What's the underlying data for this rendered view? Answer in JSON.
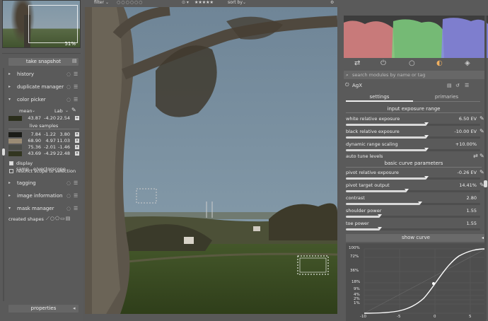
{
  "colors": {
    "accent": "#e8e8e8",
    "picker_primary": "#2b2e1c",
    "live1": "#1b1c18",
    "live2": "#9a8b75",
    "live3": "#4b4d49",
    "live4": "#323520"
  },
  "left": {
    "thumbnail_zoom": "51%",
    "snapshot_label": "take snapshot",
    "modules": [
      {
        "label": "history",
        "arrow": "▸"
      },
      {
        "label": "duplicate manager",
        "arrow": "▸"
      },
      {
        "label": "color picker",
        "arrow": "▾"
      }
    ],
    "picker": {
      "mode": "mean",
      "space": "Lab",
      "primary": [
        "43.87",
        "-4.20",
        "22.54"
      ],
      "live_samples_label": "live samples",
      "samples": [
        [
          "7.84",
          "-1.22",
          "3.80"
        ],
        [
          "68.90",
          "4.97",
          "11.03"
        ],
        [
          "75.36",
          "-2.01",
          "-1.46"
        ],
        [
          "43.69",
          "-4.29",
          "22.48"
        ]
      ],
      "display_label": "display samp...e/vectorscope",
      "restrict_label": "restrict scope to selection"
    },
    "modules2": [
      {
        "label": "tagging",
        "arrow": "▸"
      },
      {
        "label": "image information",
        "arrow": "▸"
      },
      {
        "label": "mask manager",
        "arrow": "▾"
      }
    ],
    "created_shapes": "created shapes",
    "properties_label": "properties"
  },
  "topbar": {
    "filter": "filter",
    "stars": "★★★★★",
    "sort": "sort by"
  },
  "right": {
    "search_placeholder": "search modules by name or tag",
    "module_name": "AgX",
    "tabs": [
      "settings",
      "primaries"
    ],
    "section1": "input exposure range",
    "params1": [
      {
        "label": "white relative exposure",
        "value": "6.50 EV",
        "fraction": 0.6
      },
      {
        "label": "black relative exposure",
        "value": "-10.00 EV",
        "fraction": 0.6
      },
      {
        "label": "dynamic range scaling",
        "value": "+10.00%",
        "fraction": 0.6
      }
    ],
    "auto_tune": "auto tune levels",
    "section2": "basic curve parameters",
    "params2": [
      {
        "label": "pivot relative exposure",
        "value": "-0.26 EV",
        "fraction": 0.6
      },
      {
        "label": "pivot target output",
        "value": "14.41%",
        "fraction": 0.45
      },
      {
        "label": "contrast",
        "value": "2.80",
        "fraction": 0.55
      },
      {
        "label": "shoulder power",
        "value": "1.55",
        "fraction": 0.25
      },
      {
        "label": "toe power",
        "value": "1.55",
        "fraction": 0.25
      }
    ],
    "show_curve": "show curve",
    "curve_y_ticks": [
      "100%",
      "72%",
      "36%",
      "18%",
      "9%",
      "4%",
      "2%",
      "1%"
    ],
    "curve_x_ticks": [
      "-10",
      "-5",
      "0",
      "5"
    ]
  }
}
